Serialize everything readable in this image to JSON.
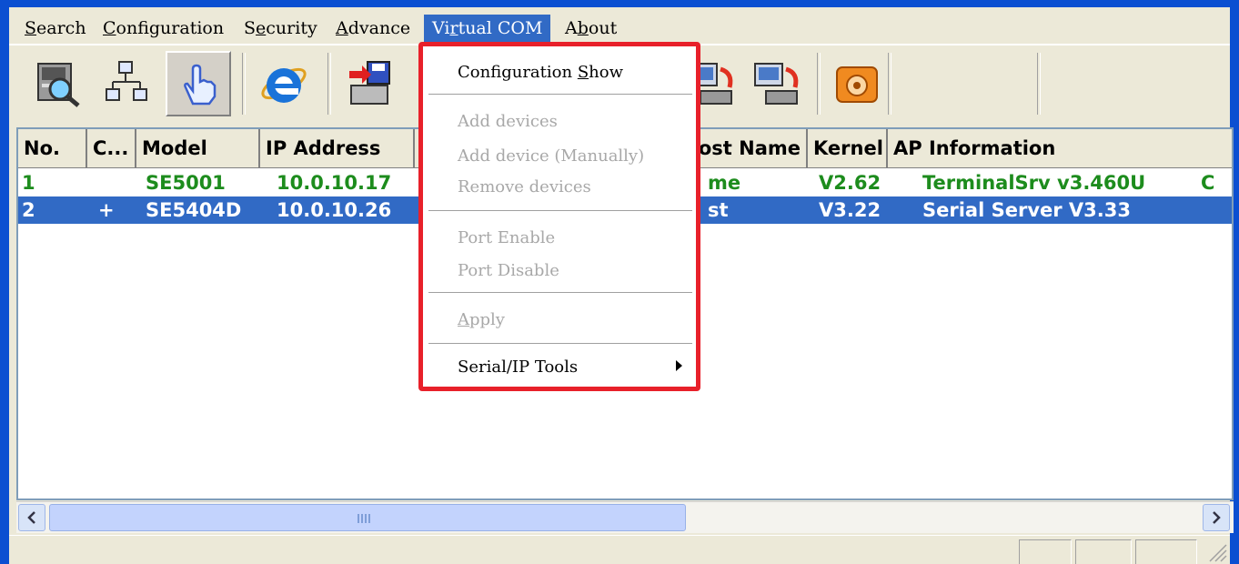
{
  "menubar": {
    "items": [
      {
        "pre": "",
        "u": "S",
        "post": "earch"
      },
      {
        "pre": "",
        "u": "C",
        "post": "onfiguration"
      },
      {
        "pre": "S",
        "u": "e",
        "post": "curity"
      },
      {
        "pre": "",
        "u": "A",
        "post": "dvance"
      },
      {
        "pre": "Vi",
        "u": "r",
        "post": "tual COM"
      },
      {
        "pre": "A",
        "u": "b",
        "post": "out"
      }
    ],
    "active_index": 4
  },
  "toolbar": {
    "buttons": [
      {
        "icon": "search-computer-icon"
      },
      {
        "icon": "network-icon"
      },
      {
        "icon": "hand-pointer-icon",
        "pressed": true
      },
      {
        "icon": "internet-explorer-icon"
      },
      {
        "icon": "save-download-icon"
      },
      {
        "icon": "computer-refresh-icon"
      },
      {
        "icon": "computer-refresh-icon"
      },
      {
        "icon": "telephone-icon"
      }
    ]
  },
  "table": {
    "columns": [
      "No.",
      "C...",
      "Model",
      "IP Address",
      "Host Name",
      "Kernel",
      "AP Information"
    ],
    "rows": [
      {
        "no": "1",
        "c": "",
        "model": "SE5001",
        "ip": "10.0.10.17",
        "host_visible": "me",
        "kernel": "V2.62",
        "ap": "TerminalSrv v3.460U",
        "extra": "C",
        "selected": false
      },
      {
        "no": "2",
        "c": "+",
        "model": "SE5404D",
        "ip": "10.0.10.26",
        "host_visible": "st",
        "kernel": "V3.22",
        "ap": "Serial Server V3.33",
        "extra": "",
        "selected": true
      }
    ]
  },
  "dropdown": {
    "items": [
      {
        "pre": "Configuration ",
        "u": "S",
        "post": "how",
        "enabled": true
      },
      {
        "pre": "Add devices",
        "u": "",
        "post": "",
        "enabled": false
      },
      {
        "pre": "Add device (Manually)",
        "u": "",
        "post": "",
        "enabled": false
      },
      {
        "pre": "Remove devices",
        "u": "",
        "post": "",
        "enabled": false
      },
      {
        "pre": "Port Enable",
        "u": "",
        "post": "",
        "enabled": false
      },
      {
        "pre": "Port Disable",
        "u": "",
        "post": "",
        "enabled": false
      },
      {
        "pre": "",
        "u": "A",
        "post": "pply",
        "enabled": false
      },
      {
        "pre": "Serial/IP Tools",
        "u": "",
        "post": "",
        "enabled": true,
        "submenu": true
      }
    ]
  },
  "colors": {
    "selection": "#316ac5",
    "highlight_border": "#e8202a",
    "online_text": "#1d8c1d",
    "title_blue": "#0b4fd1"
  }
}
